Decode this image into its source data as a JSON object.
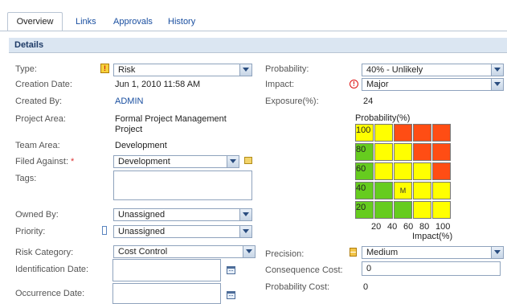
{
  "tabs": [
    {
      "label": "Overview",
      "active": true
    },
    {
      "label": "Links",
      "active": false
    },
    {
      "label": "Approvals",
      "active": false
    },
    {
      "label": "History",
      "active": false
    }
  ],
  "section": {
    "title": "Details"
  },
  "left": {
    "type": {
      "label": "Type:",
      "value": "Risk",
      "icon": "risk-icon"
    },
    "creation_date": {
      "label": "Creation Date:",
      "value": "Jun 1, 2010 11:58 AM"
    },
    "created_by": {
      "label": "Created By:",
      "value": "ADMIN"
    },
    "project_area": {
      "label": "Project Area:",
      "value_line1": "Formal Project Management",
      "value_line2": "Project"
    },
    "team_area": {
      "label": "Team Area:",
      "value": "Development"
    },
    "filed_against": {
      "label": "Filed Against:",
      "required_mark": "*",
      "value": "Development"
    },
    "tags": {
      "label": "Tags:",
      "value": ""
    },
    "owned_by": {
      "label": "Owned By:",
      "value": "Unassigned"
    },
    "priority": {
      "label": "Priority:",
      "value": "Unassigned"
    },
    "risk_category": {
      "label": "Risk Category:",
      "value": "Cost Control"
    },
    "identification_date": {
      "label": "Identification Date:",
      "value": ""
    },
    "occurrence_date": {
      "label": "Occurrence Date:",
      "value": ""
    }
  },
  "right": {
    "probability": {
      "label": "Probability:",
      "value": "40% - Unlikely"
    },
    "impact": {
      "label": "Impact:",
      "value": "Major",
      "icon": "major-impact-icon"
    },
    "exposure": {
      "label": "Exposure(%):",
      "value": "24"
    },
    "precision": {
      "label": "Precision:",
      "value": "Medium"
    },
    "consequence_cost": {
      "label": "Consequence Cost:",
      "value": "0"
    },
    "probability_cost": {
      "label": "Probability Cost:",
      "value": "0"
    }
  },
  "matrix": {
    "ylabel": "Probability(%)",
    "xlabel": "Impact(%)",
    "y_ticks": [
      "100",
      "80",
      "60",
      "40",
      "20"
    ],
    "x_ticks": [
      "20",
      "40",
      "60",
      "80",
      "100"
    ],
    "marker": "M",
    "marker_row": 3,
    "marker_col": 2,
    "colors": {
      "green": "#66cc1f",
      "yellow": "#ffff00",
      "red": "#ff4d14"
    },
    "rows": [
      [
        "yellow",
        "yellow",
        "red",
        "red",
        "red"
      ],
      [
        "green",
        "yellow",
        "yellow",
        "red",
        "red"
      ],
      [
        "green",
        "yellow",
        "yellow",
        "yellow",
        "red"
      ],
      [
        "green",
        "green",
        "yellow",
        "yellow",
        "yellow"
      ],
      [
        "green",
        "green",
        "green",
        "yellow",
        "yellow"
      ]
    ]
  }
}
